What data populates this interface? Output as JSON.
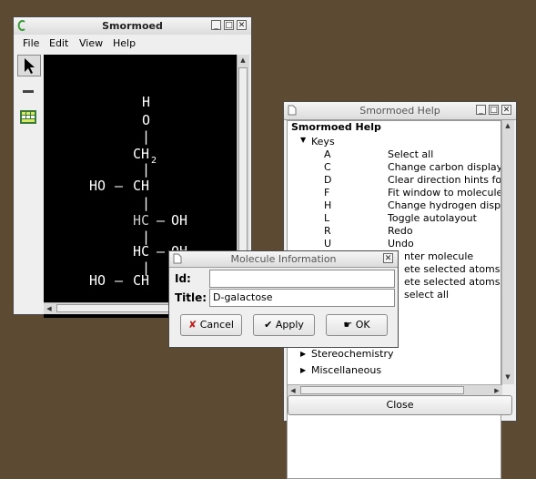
{
  "main_window": {
    "title": "Smormoed",
    "menu": [
      "File",
      "Edit",
      "View",
      "Help"
    ],
    "molecule_atoms": [
      "HO",
      "CH",
      "CH",
      "HO",
      "HC",
      "OH",
      "HC",
      "OH",
      "HO",
      "CH",
      "CH",
      "O"
    ],
    "subscript": "2",
    "bond_h": "–",
    "bond_v": "|",
    "bond_double": "//"
  },
  "help_window": {
    "title": "Smormoed Help",
    "heading": "Smormoed Help",
    "keys_label": "Keys",
    "keys": [
      {
        "key": "A",
        "desc": "Select all"
      },
      {
        "key": "C",
        "desc": "Change carbon display"
      },
      {
        "key": "D",
        "desc": "Clear direction hints for s"
      },
      {
        "key": "F",
        "desc": "Fit window to molecule"
      },
      {
        "key": "H",
        "desc": "Change hydrogen displa"
      },
      {
        "key": "L",
        "desc": "Toggle autolayout"
      },
      {
        "key": "R",
        "desc": "Redo"
      },
      {
        "key": "U",
        "desc": "Undo"
      },
      {
        "key": "",
        "desc": "nter molecule"
      },
      {
        "key": "",
        "desc": "ete selected atoms"
      },
      {
        "key": "",
        "desc": "ete selected atoms"
      },
      {
        "key": "",
        "desc": "select all"
      }
    ],
    "sections": [
      "Stereochemistry",
      "Miscellaneous"
    ],
    "close_label": "Close"
  },
  "dialog": {
    "title": "Molecule Information",
    "id_label": "Id:",
    "id_value": "",
    "title_label": "Title:",
    "title_value": "D-galactose",
    "cancel_label": "Cancel",
    "apply_label": "Apply",
    "ok_label": "OK"
  },
  "colors": {
    "desktop": "#5c4a33",
    "canvas": "#000000",
    "atom": "#ffffff"
  }
}
